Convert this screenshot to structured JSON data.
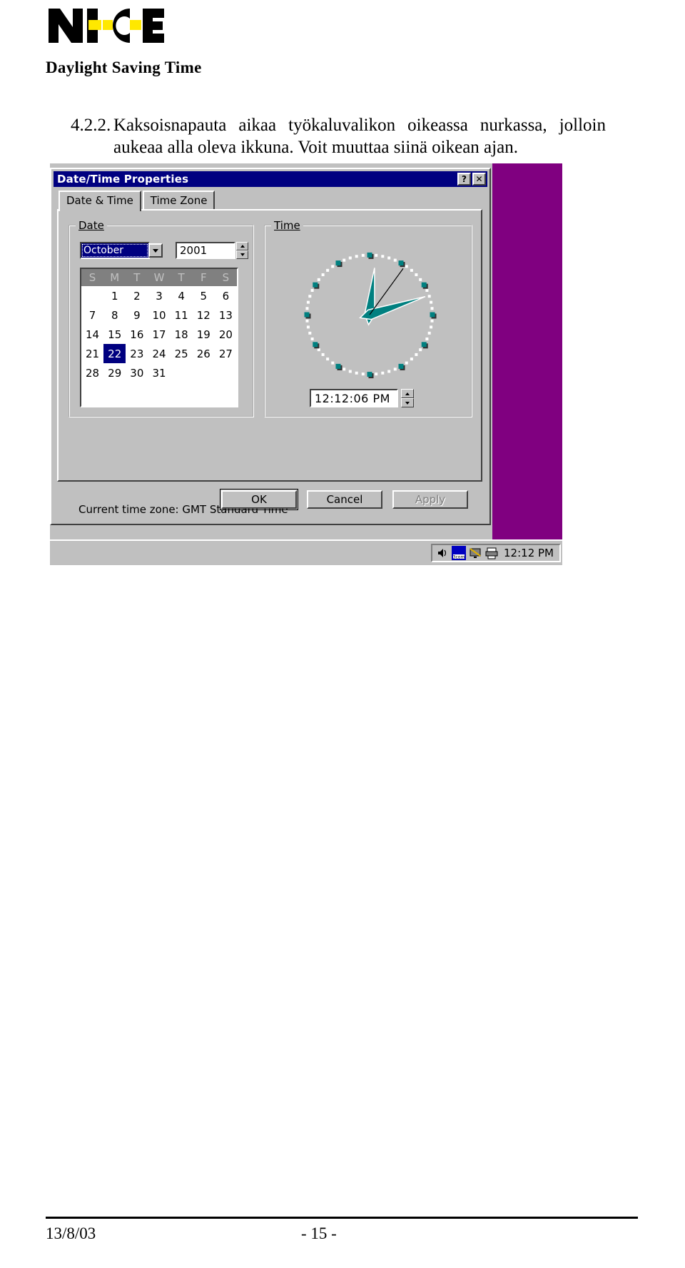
{
  "document": {
    "logo_text": "NICE",
    "title": "Daylight Saving Time",
    "footer_date": "13/8/03",
    "footer_page": "- 15 -"
  },
  "step": {
    "number": "4.2.2.",
    "text": "Kaksoisnapauta aikaa työkaluvalikon oikeassa nurkassa, jolloin aukeaa alla oleva ikkuna. Voit muuttaa siinä oikean ajan."
  },
  "dialog": {
    "title": "Date/Time Properties",
    "help_button": "?",
    "close_button": "✕",
    "tabs": [
      {
        "label": "Date & Time",
        "active": true
      },
      {
        "label": "Time Zone",
        "active": false
      }
    ],
    "date_group": {
      "label": "Date",
      "month": "October",
      "year": "2001",
      "weekday_headers": [
        "S",
        "M",
        "T",
        "W",
        "T",
        "F",
        "S"
      ],
      "weeks": [
        [
          "",
          "1",
          "2",
          "3",
          "4",
          "5",
          "6"
        ],
        [
          "7",
          "8",
          "9",
          "10",
          "11",
          "12",
          "13"
        ],
        [
          "14",
          "15",
          "16",
          "17",
          "18",
          "19",
          "20"
        ],
        [
          "21",
          "22",
          "23",
          "24",
          "25",
          "26",
          "27"
        ],
        [
          "28",
          "29",
          "30",
          "31",
          "",
          "",
          ""
        ]
      ],
      "selected_day": "22"
    },
    "time_group": {
      "label": "Time",
      "value": "12:12:06 PM",
      "clock_hour_angle": 6,
      "clock_minute_angle": 72,
      "clock_second_angle": 36
    },
    "timezone_line": "Current time zone: GMT Standard Time",
    "buttons": [
      {
        "label": "OK",
        "state": "default"
      },
      {
        "label": "Cancel",
        "state": "normal"
      },
      {
        "label": "Apply",
        "state": "disabled"
      }
    ]
  },
  "taskbar": {
    "tray_icons": [
      "speaker-icon",
      "network-3com-icon",
      "display-icon",
      "printer-icon"
    ],
    "network_label": "3com",
    "clock": "12:12 PM"
  },
  "colors": {
    "titlebar": "#000080",
    "dialog_face": "#c0c0c0",
    "desktop_purple": "#800080",
    "clock_teal": "#008080",
    "logo_yellow": "#ffe800",
    "selection": "#000080"
  }
}
